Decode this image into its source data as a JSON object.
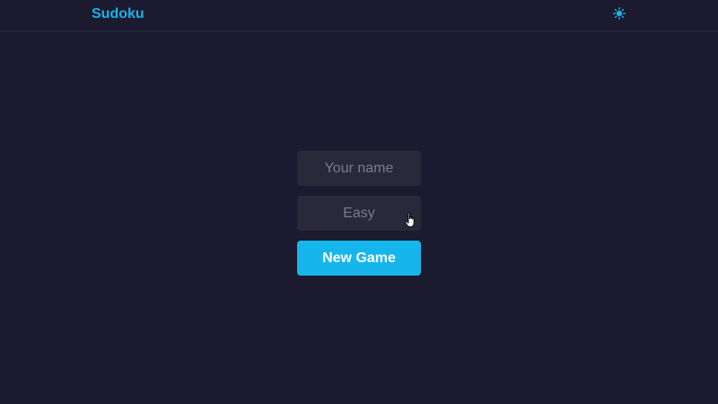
{
  "header": {
    "title": "Sudoku",
    "theme_icon": "sun-icon",
    "accent_color": "#1ab2e8"
  },
  "form": {
    "name_placeholder": "Your name",
    "difficulty_value": "Easy",
    "new_game_label": "New Game",
    "button_color": "#16b6ec"
  },
  "pointer": {
    "icon": "hand-cursor-icon"
  }
}
